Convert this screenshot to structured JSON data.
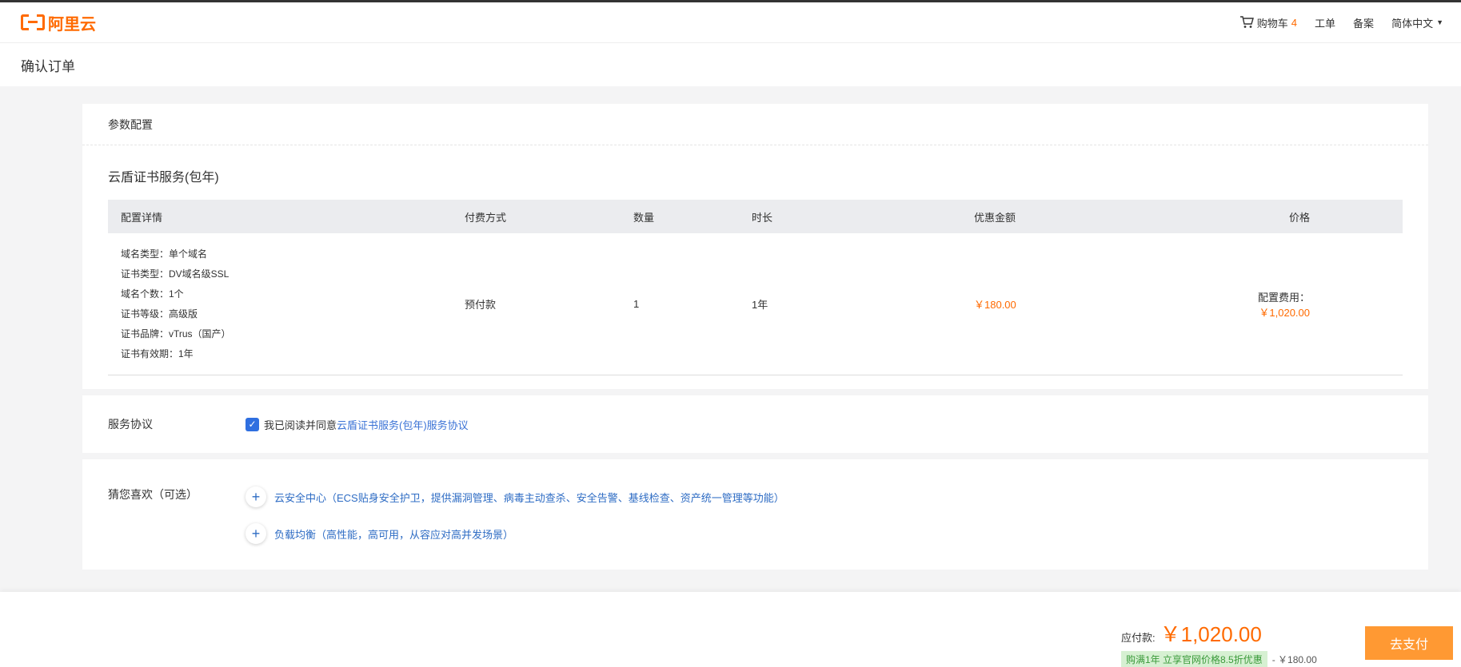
{
  "header": {
    "logo_text": "阿里云",
    "cart_label": "购物车",
    "cart_count": "4",
    "ticket_label": "工单",
    "filing_label": "备案",
    "language_label": "简体中文",
    "accent_color": "#ff6a00"
  },
  "page_title": "确认订单",
  "config_section": {
    "title": "参数配置",
    "product_name": "云盾证书服务(包年)",
    "columns": [
      "配置详情",
      "付费方式",
      "数量",
      "时长",
      "优惠金额",
      "价格"
    ],
    "details": [
      "域名类型：单个域名",
      "证书类型：DV域名级SSL",
      "域名个数：1个",
      "证书等级：高级版",
      "证书品牌：vTrus（国产）",
      "证书有效期：1年"
    ],
    "payment_method": "预付款",
    "quantity": "1",
    "duration": "1年",
    "discount": "￥180.00",
    "price_label": "配置费用：",
    "price_value": "￥1,020.00"
  },
  "agreement_section": {
    "title": "服务协议",
    "checked": true,
    "text": "我已阅读并同意",
    "link_text": "云盾证书服务(包年)服务协议"
  },
  "recommend_section": {
    "title": "猜您喜欢（可选）",
    "items": [
      "云安全中心（ECS贴身安全护卫，提供漏洞管理、病毒主动查杀、安全告警、基线检查、资产统一管理等功能）",
      "负载均衡（高性能，高可用，从容应对高并发场景）"
    ]
  },
  "footer": {
    "pay_label": "应付款:",
    "pay_amount": "￥1,020.00",
    "promo_text": "购满1年 立享官网价格8.5折优惠",
    "promo_discount": "- ￥180.00",
    "pay_button": "去支付"
  }
}
